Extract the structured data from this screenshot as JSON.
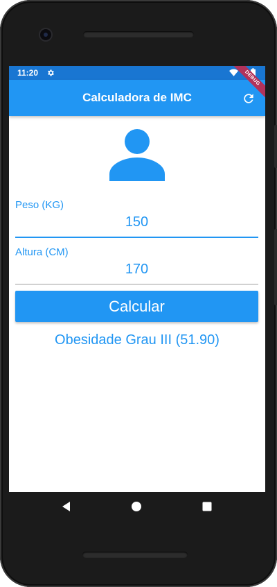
{
  "status_bar": {
    "time": "11:20",
    "settings_icon": "gear-icon",
    "wifi_icon": "wifi-icon",
    "battery_icon": "battery-icon",
    "color": "#1976d2"
  },
  "debug_banner": {
    "label": "DEBUG",
    "color": "#b2325a"
  },
  "app_bar": {
    "title": "Calculadora de IMC",
    "refresh_icon": "refresh-icon",
    "color": "#2196f3"
  },
  "avatar": {
    "icon": "person-icon"
  },
  "form": {
    "peso": {
      "label": "Peso (KG)",
      "value": "150"
    },
    "altura": {
      "label": "Altura (CM)",
      "value": "170"
    },
    "calcular_label": "Calcular"
  },
  "result": {
    "text": "Obesidade Grau III (51.90)"
  },
  "nav_bar": {
    "back_icon": "back-icon",
    "home_icon": "home-icon",
    "recents_icon": "recents-icon"
  },
  "colors": {
    "primary": "#2196f3",
    "primary_dark": "#1976d2"
  }
}
